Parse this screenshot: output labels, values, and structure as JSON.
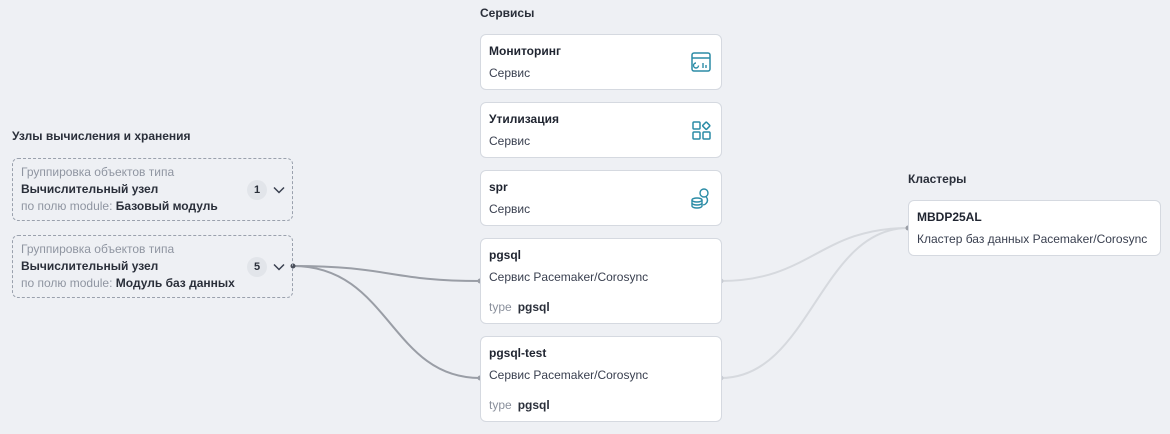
{
  "compute_column": {
    "title": "Узлы вычисления и хранения",
    "groups": [
      {
        "header": "Группировка объектов типа",
        "type_name": "Вычислительный узел",
        "field_prefix": "по полю module:",
        "field_value": "Базовый модуль",
        "count": "1"
      },
      {
        "header": "Группировка объектов типа",
        "type_name": "Вычислительный узел",
        "field_prefix": "по полю module:",
        "field_value": "Модуль баз данных",
        "count": "5"
      }
    ]
  },
  "services_column": {
    "title": "Сервисы",
    "cards": [
      {
        "name": "Мониторинг",
        "subtitle": "Сервис",
        "icon": "monitoring-icon"
      },
      {
        "name": "Утилизация",
        "subtitle": "Сервис",
        "icon": "utilization-icon"
      },
      {
        "name": "spr",
        "subtitle": "Сервис",
        "icon": "database-search-icon"
      },
      {
        "name": "pgsql",
        "subtitle": "Сервис Pacemaker/Corosync",
        "attr_key": "type",
        "attr_value": "pgsql"
      },
      {
        "name": "pgsql-test",
        "subtitle": "Сервис Pacemaker/Corosync",
        "attr_key": "type",
        "attr_value": "pgsql"
      }
    ]
  },
  "clusters_column": {
    "title": "Кластеры",
    "cards": [
      {
        "name": "MBDP25AL",
        "subtitle": "Кластер баз данных Pacemaker/Corosync"
      }
    ]
  },
  "colors": {
    "icon_accent": "#2b8ca6",
    "active_link": "#9a9ea6",
    "inactive_link": "#d6d9de"
  }
}
